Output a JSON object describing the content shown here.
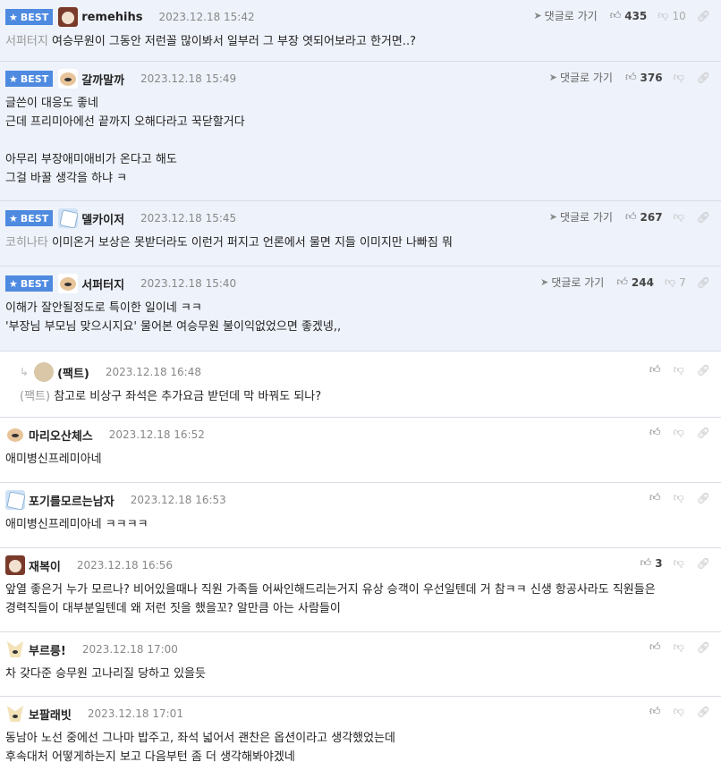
{
  "ui": {
    "best_label": "BEST",
    "go_reply_label": "댓글로 가기"
  },
  "comments": [
    {
      "best": true,
      "nick": "remehihs",
      "date": "2023.12.18 15:42",
      "likes": "435",
      "dislikes": "10",
      "prefix": "서퍼터지",
      "lines": [
        "여승무원이 그동안 저런꼴 많이봐서 일부러 그 부장 엿되어보라고 한거면..?"
      ]
    },
    {
      "best": true,
      "nick": "갈까말까",
      "date": "2023.12.18 15:49",
      "likes": "376",
      "lines": [
        "글쓴이 대응도 좋네",
        "근데 프리미아에선 끝까지 오해다라고 꾹닫할거다",
        "",
        "아무리 부장애미애비가 온다고 해도",
        "그걸 바꿀 생각을 하냐 ㅋ"
      ]
    },
    {
      "best": true,
      "nick": "델카이저",
      "date": "2023.12.18 15:45",
      "likes": "267",
      "prefix": "코히나타",
      "lines": [
        "이미온거 보상은 못받더라도 이런거 퍼지고 언론에서 물면 지들 이미지만 나빠짐 뭐"
      ]
    },
    {
      "best": true,
      "nick": "서퍼터지",
      "date": "2023.12.18 15:40",
      "likes": "244",
      "dislikes": "7",
      "lines": [
        "이해가 잘안될정도로 특이한 일이네 ㅋㅋ",
        "'부장님 부모님 맞으시지요' 물어본 여승무원 불이익없었으면 좋겠넹,,"
      ]
    },
    {
      "reply": true,
      "nick": "(팩트)",
      "date": "2023.12.18 16:48",
      "prefix": "(팩트)",
      "lines": [
        "참고로 비상구 좌석은 추가요금 받던데 막 바꿔도 되나?"
      ]
    },
    {
      "nick": "마리오산체스",
      "date": "2023.12.18 16:52",
      "lines": [
        "애미병신프레미아네"
      ]
    },
    {
      "nick": "포기를모르는남자",
      "date": "2023.12.18 16:53",
      "lines": [
        "애미병신프레미아네 ㅋㅋㅋㅋ"
      ]
    },
    {
      "nick": "재복이",
      "date": "2023.12.18 16:56",
      "likes": "3",
      "lines": [
        "앞열 좋은거 누가 모르나? 비어있을때나 직원 가족들 어싸인해드리는거지 유상 승객이 우선일텐데 거 참ㅋㅋ 신생 항공사라도 직원들은",
        "경력직들이 대부분일텐데 왜 저런 짓을 했을꼬? 알만큼 아는 사람들이"
      ]
    },
    {
      "nick": "부르릉!",
      "date": "2023.12.18 17:00",
      "lines": [
        "차 갖다준 승무원 고나리질 당하고 있을듯"
      ]
    },
    {
      "nick": "보팔래빗",
      "date": "2023.12.18 17:01",
      "lines": [
        "동남아 노선 중에선 그나마 밥주고, 좌석 넓어서 괜찬은 옵션이라고 생각했었는데",
        "후속대처 어떻게하는지 보고 다음부턴 좀 더 생각해봐야겠네"
      ]
    }
  ]
}
